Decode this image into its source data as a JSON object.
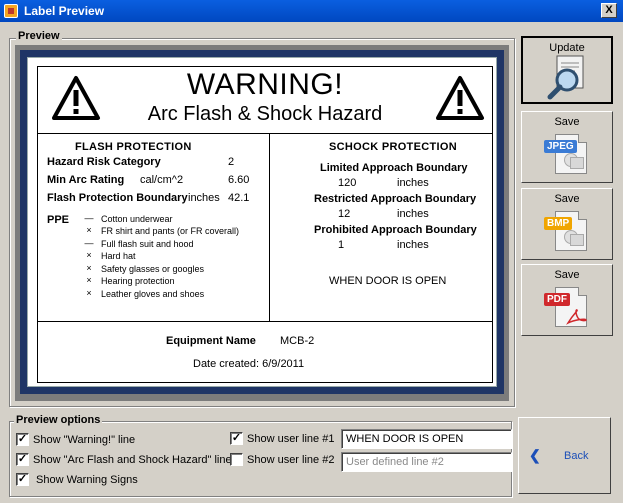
{
  "window": {
    "title": "Label Preview",
    "close_glyph": "X"
  },
  "preview": {
    "group_title": "Preview",
    "label": {
      "warning": "WARNING!",
      "hazard": "Arc Flash & Shock Hazard",
      "flash_protection": {
        "title": "FLASH PROTECTION",
        "hazard_risk_category_label": "Hazard Risk Category",
        "hazard_risk_category_value": "2",
        "min_arc_rating_label": "Min Arc Rating",
        "min_arc_rating_unit": "cal/cm^2",
        "min_arc_rating_value": "6.60",
        "flash_boundary_label": "Flash Protection Boundary",
        "flash_boundary_unit": "inches",
        "flash_boundary_value": "42.1",
        "ppe_label": "PPE",
        "ppe_items": [
          {
            "mark": "—",
            "text": "Cotton underwear"
          },
          {
            "mark": "×",
            "text": "FR shirt and pants (or FR coverall)"
          },
          {
            "mark": "—",
            "text": "Full flash suit and hood"
          },
          {
            "mark": "×",
            "text": "Hard hat"
          },
          {
            "mark": "×",
            "text": "Safety glasses or googles"
          },
          {
            "mark": "×",
            "text": "Hearing protection"
          },
          {
            "mark": "×",
            "text": "Leather gloves and shoes"
          }
        ]
      },
      "shock_protection": {
        "title": "SCHOCK PROTECTION",
        "limited_label": "Limited Approach Boundary",
        "limited_value": "120",
        "limited_unit": "inches",
        "restricted_label": "Restricted Approach Boundary",
        "restricted_value": "12",
        "restricted_unit": "inches",
        "prohibited_label": "Prohibited Approach Boundary",
        "prohibited_value": "1",
        "prohibited_unit": "inches",
        "user_line": "WHEN DOOR IS OPEN"
      },
      "equipment_name_label": "Equipment Name",
      "equipment_name_value": "MCB-2",
      "date_created": "Date created: 6/9/2011"
    }
  },
  "buttons": {
    "update": "Update",
    "save_jpeg": {
      "caption": "Save",
      "badge": "JPEG",
      "badge_color": "#3a7bd5"
    },
    "save_bmp": {
      "caption": "Save",
      "badge": "BMP",
      "badge_color": "#f0a500"
    },
    "save_pdf": {
      "caption": "Save",
      "badge": "PDF",
      "badge_color": "#d0282c"
    },
    "back": "Back"
  },
  "options": {
    "group_title": "Preview options",
    "show_warning_line": {
      "label": "Show \"Warning!\" line",
      "checked": true
    },
    "show_arc_flash_line": {
      "label": "Show \"Arc Flash and Shock Hazard\" line",
      "checked": true
    },
    "show_warning_signs": {
      "label": "Show Warning Signs",
      "checked": true
    },
    "show_user_line_1": {
      "label": "Show user line #1",
      "checked": true,
      "value": "WHEN DOOR IS OPEN"
    },
    "show_user_line_2": {
      "label": "Show user line #2",
      "checked": false,
      "placeholder": "User defined line #2"
    },
    "check_glyph": "✓"
  }
}
